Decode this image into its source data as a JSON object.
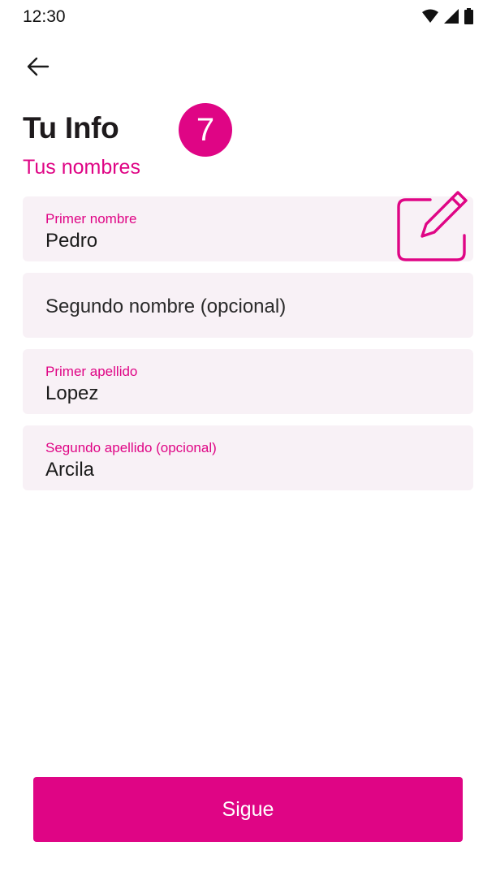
{
  "colors": {
    "accent": "#df0585",
    "field_bg": "#f8f1f6"
  },
  "status_bar": {
    "time": "12:30",
    "icons": [
      "wifi-icon",
      "signal-icon",
      "battery-icon"
    ]
  },
  "header": {
    "back_icon": "arrow-left-icon",
    "title": "Tu Info",
    "step_number": "7",
    "subtitle": "Tus nombres"
  },
  "form": {
    "fields": [
      {
        "label": "Primer nombre",
        "value": "Pedro"
      },
      {
        "placeholder": "Segundo nombre (opcional)"
      },
      {
        "label": "Primer apellido",
        "value": "Lopez"
      },
      {
        "label": "Segundo apellido (opcional)",
        "value": "Arcila"
      }
    ]
  },
  "annotation": {
    "icon": "edit-pencil-icon"
  },
  "footer": {
    "continue_label": "Sigue"
  }
}
